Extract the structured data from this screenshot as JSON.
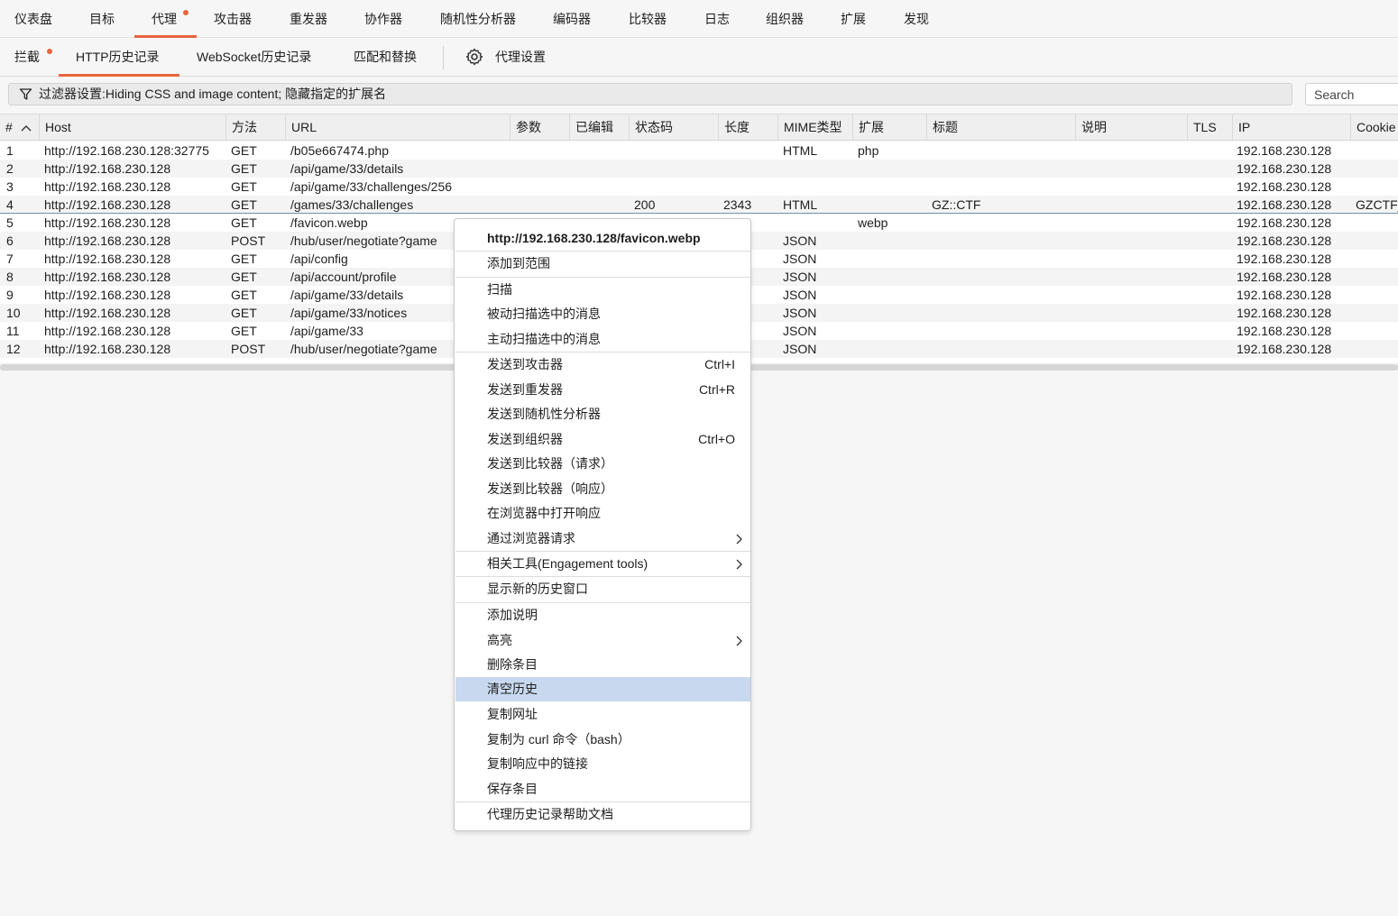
{
  "top_tabs": [
    {
      "label": "仪表盘"
    },
    {
      "label": "目标"
    },
    {
      "label": "代理"
    },
    {
      "label": "攻击器"
    },
    {
      "label": "重发器"
    },
    {
      "label": "协作器"
    },
    {
      "label": "随机性分析器"
    },
    {
      "label": "编码器"
    },
    {
      "label": "比较器"
    },
    {
      "label": "日志"
    },
    {
      "label": "组织器"
    },
    {
      "label": "扩展"
    },
    {
      "label": "发现"
    }
  ],
  "sub_tabs": [
    {
      "label": "拦截"
    },
    {
      "label": "HTTP历史记录"
    },
    {
      "label": "WebSocket历史记录"
    },
    {
      "label": "匹配和替换"
    },
    {
      "label": "代理设置"
    }
  ],
  "filter": {
    "text": "过滤器设置:Hiding CSS and image content; 隐藏指定的扩展名"
  },
  "search": {
    "placeholder": "Search"
  },
  "table": {
    "columns": [
      "#",
      "Host",
      "方法",
      "URL",
      "参数",
      "已编辑",
      "状态码",
      "长度",
      "MIME类型",
      "扩展",
      "标题",
      "说明",
      "TLS",
      "IP",
      "Cookie"
    ],
    "rows": [
      {
        "num": "1",
        "host": "http://192.168.230.128:32775",
        "method": "GET",
        "url": "/b05e667474.php",
        "status": "",
        "length": "",
        "mime": "HTML",
        "ext": "php",
        "title": "",
        "ip": "192.168.230.128",
        "cookie": ""
      },
      {
        "num": "2",
        "host": "http://192.168.230.128",
        "method": "GET",
        "url": "/api/game/33/details",
        "status": "",
        "length": "",
        "mime": "",
        "ext": "",
        "title": "",
        "ip": "192.168.230.128",
        "cookie": ""
      },
      {
        "num": "3",
        "host": "http://192.168.230.128",
        "method": "GET",
        "url": "/api/game/33/challenges/256",
        "status": "",
        "length": "",
        "mime": "",
        "ext": "",
        "title": "",
        "ip": "192.168.230.128",
        "cookie": ""
      },
      {
        "num": "4",
        "host": "http://192.168.230.128",
        "method": "GET",
        "url": "/games/33/challenges",
        "status": "200",
        "length": "2343",
        "mime": "HTML",
        "ext": "",
        "title": "GZ::CTF",
        "ip": "192.168.230.128",
        "cookie": "GZCTF_"
      },
      {
        "num": "5",
        "host": "http://192.168.230.128",
        "method": "GET",
        "url": "/favicon.webp",
        "status": "",
        "length": "",
        "mime": "",
        "ext": "webp",
        "title": "",
        "ip": "192.168.230.128",
        "cookie": ""
      },
      {
        "num": "6",
        "host": "http://192.168.230.128",
        "method": "POST",
        "url": "/hub/user/negotiate?game",
        "status": "",
        "length": "",
        "mime": "JSON",
        "ext": "",
        "title": "",
        "ip": "192.168.230.128",
        "cookie": ""
      },
      {
        "num": "7",
        "host": "http://192.168.230.128",
        "method": "GET",
        "url": "/api/config",
        "status": "",
        "length": "",
        "mime": "JSON",
        "ext": "",
        "title": "",
        "ip": "192.168.230.128",
        "cookie": ""
      },
      {
        "num": "8",
        "host": "http://192.168.230.128",
        "method": "GET",
        "url": "/api/account/profile",
        "status": "",
        "length": "",
        "mime": "JSON",
        "ext": "",
        "title": "",
        "ip": "192.168.230.128",
        "cookie": ""
      },
      {
        "num": "9",
        "host": "http://192.168.230.128",
        "method": "GET",
        "url": "/api/game/33/details",
        "status": "",
        "length": "",
        "mime": "JSON",
        "ext": "",
        "title": "",
        "ip": "192.168.230.128",
        "cookie": ""
      },
      {
        "num": "10",
        "host": "http://192.168.230.128",
        "method": "GET",
        "url": "/api/game/33/notices",
        "status": "",
        "length": "",
        "mime": "JSON",
        "ext": "",
        "title": "",
        "ip": "192.168.230.128",
        "cookie": ""
      },
      {
        "num": "11",
        "host": "http://192.168.230.128",
        "method": "GET",
        "url": "/api/game/33",
        "status": "",
        "length": "",
        "mime": "JSON",
        "ext": "",
        "title": "",
        "ip": "192.168.230.128",
        "cookie": ""
      },
      {
        "num": "12",
        "host": "http://192.168.230.128",
        "method": "POST",
        "url": "/hub/user/negotiate?game",
        "status": "",
        "length": "",
        "mime": "JSON",
        "ext": "",
        "title": "",
        "ip": "192.168.230.128",
        "cookie": ""
      }
    ]
  },
  "context_menu": {
    "header": "http://192.168.230.128/favicon.webp",
    "items": [
      {
        "label": "添加到范围"
      },
      {
        "label": "扫描"
      },
      {
        "label": "被动扫描选中的消息"
      },
      {
        "label": "主动扫描选中的消息"
      },
      {
        "label": "发送到攻击器",
        "shortcut": "Ctrl+I"
      },
      {
        "label": "发送到重发器",
        "shortcut": "Ctrl+R"
      },
      {
        "label": "发送到随机性分析器"
      },
      {
        "label": "发送到组织器",
        "shortcut": "Ctrl+O"
      },
      {
        "label": "发送到比较器（请求）"
      },
      {
        "label": "发送到比较器（响应）"
      },
      {
        "label": "在浏览器中打开响应"
      },
      {
        "label": "通过浏览器请求"
      },
      {
        "label": "相关工具(Engagement tools)"
      },
      {
        "label": "显示新的历史窗口"
      },
      {
        "label": "添加说明"
      },
      {
        "label": "高亮"
      },
      {
        "label": "删除条目"
      },
      {
        "label": "清空历史"
      },
      {
        "label": "复制网址"
      },
      {
        "label": "复制为 curl 命令（bash）"
      },
      {
        "label": "复制响应中的链接"
      },
      {
        "label": "保存条目"
      },
      {
        "label": "代理历史记录帮助文档"
      }
    ]
  },
  "colors": {
    "accent": "#e8643c",
    "menu_highlight": "#c8d9ef",
    "selection_border": "#6f8fb0"
  }
}
